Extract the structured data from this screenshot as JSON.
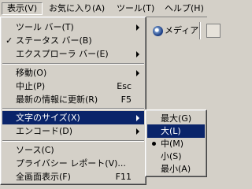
{
  "menubar": {
    "items": [
      "表示(V)",
      "お気に入り(A)",
      "ツール(T)",
      "ヘルプ(H)"
    ]
  },
  "toolbar": {
    "media_label": "メディア"
  },
  "view_menu": {
    "items": [
      {
        "label": "ツール バー(T)",
        "submenu": true
      },
      {
        "label": "ステータス バー(B)",
        "checked": true
      },
      {
        "label": "エクスプローラ バー(E)",
        "submenu": true
      },
      {
        "label": "移動(O)",
        "submenu": true
      },
      {
        "label": "中止(P)",
        "shortcut": "Esc"
      },
      {
        "label": "最新の情報に更新(R)",
        "shortcut": "F5"
      },
      {
        "label": "文字のサイズ(X)",
        "submenu": true,
        "highlighted": true
      },
      {
        "label": "エンコード(D)",
        "submenu": true
      },
      {
        "label": "ソース(C)"
      },
      {
        "label": "プライバシー レポート(V)..."
      },
      {
        "label": "全画面表示(F)",
        "shortcut": "F11"
      }
    ]
  },
  "text_size_menu": {
    "items": [
      {
        "label": "最大(G)"
      },
      {
        "label": "大(L)",
        "highlighted": true
      },
      {
        "label": "中(M)",
        "selected": true
      },
      {
        "label": "小(S)"
      },
      {
        "label": "最小(A)"
      }
    ]
  }
}
